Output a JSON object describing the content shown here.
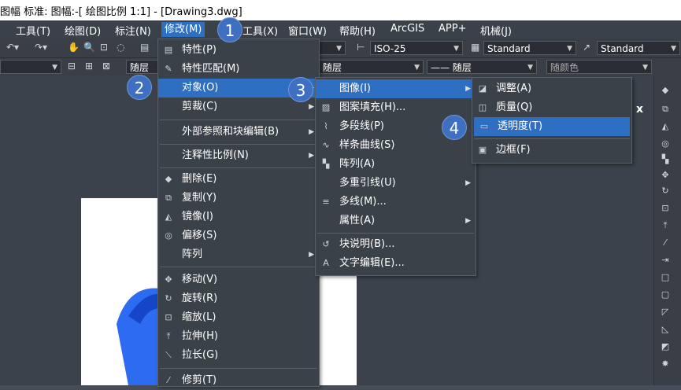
{
  "title": "图幅 标准: 图幅:-[ 绘图比例 1:1] - [Drawing3.dwg]",
  "menubar": [
    {
      "label": "工具(T)"
    },
    {
      "label": "绘图(D)"
    },
    {
      "label": "标注(N)"
    },
    {
      "label": "修改(M)"
    },
    {
      "label": "工具(X)"
    },
    {
      "label": "窗口(W)"
    },
    {
      "label": "帮助(H)"
    },
    {
      "label": "ArcGIS"
    },
    {
      "label": "APP+"
    },
    {
      "label": "机械(J)"
    }
  ],
  "toolbar": {
    "dimstyle": "ISO-25",
    "textstyle1": "Standard",
    "textstyle2": "Standard",
    "layer_left": "随层",
    "layer_mid": "随层",
    "linetype": "—— 随层",
    "color": "随颜色"
  },
  "close_label": "x",
  "badges": [
    "1",
    "2",
    "3",
    "4"
  ],
  "modify_menu": [
    {
      "label": "特性(P)",
      "icon": "properties-icon"
    },
    {
      "label": "特性匹配(M)",
      "icon": "match-brush-icon"
    },
    {
      "label": "对象(O)",
      "submenu": true
    },
    {
      "label": "剪裁(C)",
      "submenu": true
    },
    {
      "label": "外部参照和块编辑(B)",
      "submenu": true
    },
    {
      "label": "注释性比例(N)",
      "submenu": true
    },
    {
      "label": "删除(E)",
      "icon": "eraser-icon"
    },
    {
      "label": "复制(Y)",
      "icon": "copy-icon"
    },
    {
      "label": "镜像(I)",
      "icon": "mirror-icon"
    },
    {
      "label": "偏移(S)",
      "icon": "offset-icon"
    },
    {
      "label": "阵列",
      "submenu": true
    },
    {
      "label": "移动(V)",
      "icon": "move-icon"
    },
    {
      "label": "旋转(R)",
      "icon": "rotate-icon"
    },
    {
      "label": "缩放(L)",
      "icon": "scale-icon"
    },
    {
      "label": "拉伸(H)",
      "icon": "stretch-icon"
    },
    {
      "label": "拉长(G)",
      "icon": "lengthen-icon"
    },
    {
      "label": "修剪(T)",
      "icon": "trim-icon"
    }
  ],
  "object_menu": [
    {
      "label": "图像(I)",
      "submenu": true
    },
    {
      "label": "图案填充(H)...",
      "icon": "hatch-icon"
    },
    {
      "label": "多段线(P)",
      "icon": "polyline-icon"
    },
    {
      "label": "样条曲线(S)",
      "icon": "spline-icon"
    },
    {
      "label": "阵列(A)",
      "icon": "array-icon"
    },
    {
      "label": "多重引线(U)",
      "submenu": true
    },
    {
      "label": "多线(M)...",
      "icon": "multiline-icon"
    },
    {
      "label": "属性(A)",
      "submenu": true
    },
    {
      "label": "块说明(B)...",
      "icon": "block-desc-icon"
    },
    {
      "label": "文字编辑(E)...",
      "icon": "text-edit-icon"
    }
  ],
  "image_menu": [
    {
      "label": "调整(A)",
      "icon": "adjust-icon"
    },
    {
      "label": "质量(Q)",
      "icon": "quality-icon"
    },
    {
      "label": "透明度(T)",
      "icon": "transparency-icon"
    },
    {
      "label": "边框(F)",
      "icon": "frame-icon"
    }
  ]
}
